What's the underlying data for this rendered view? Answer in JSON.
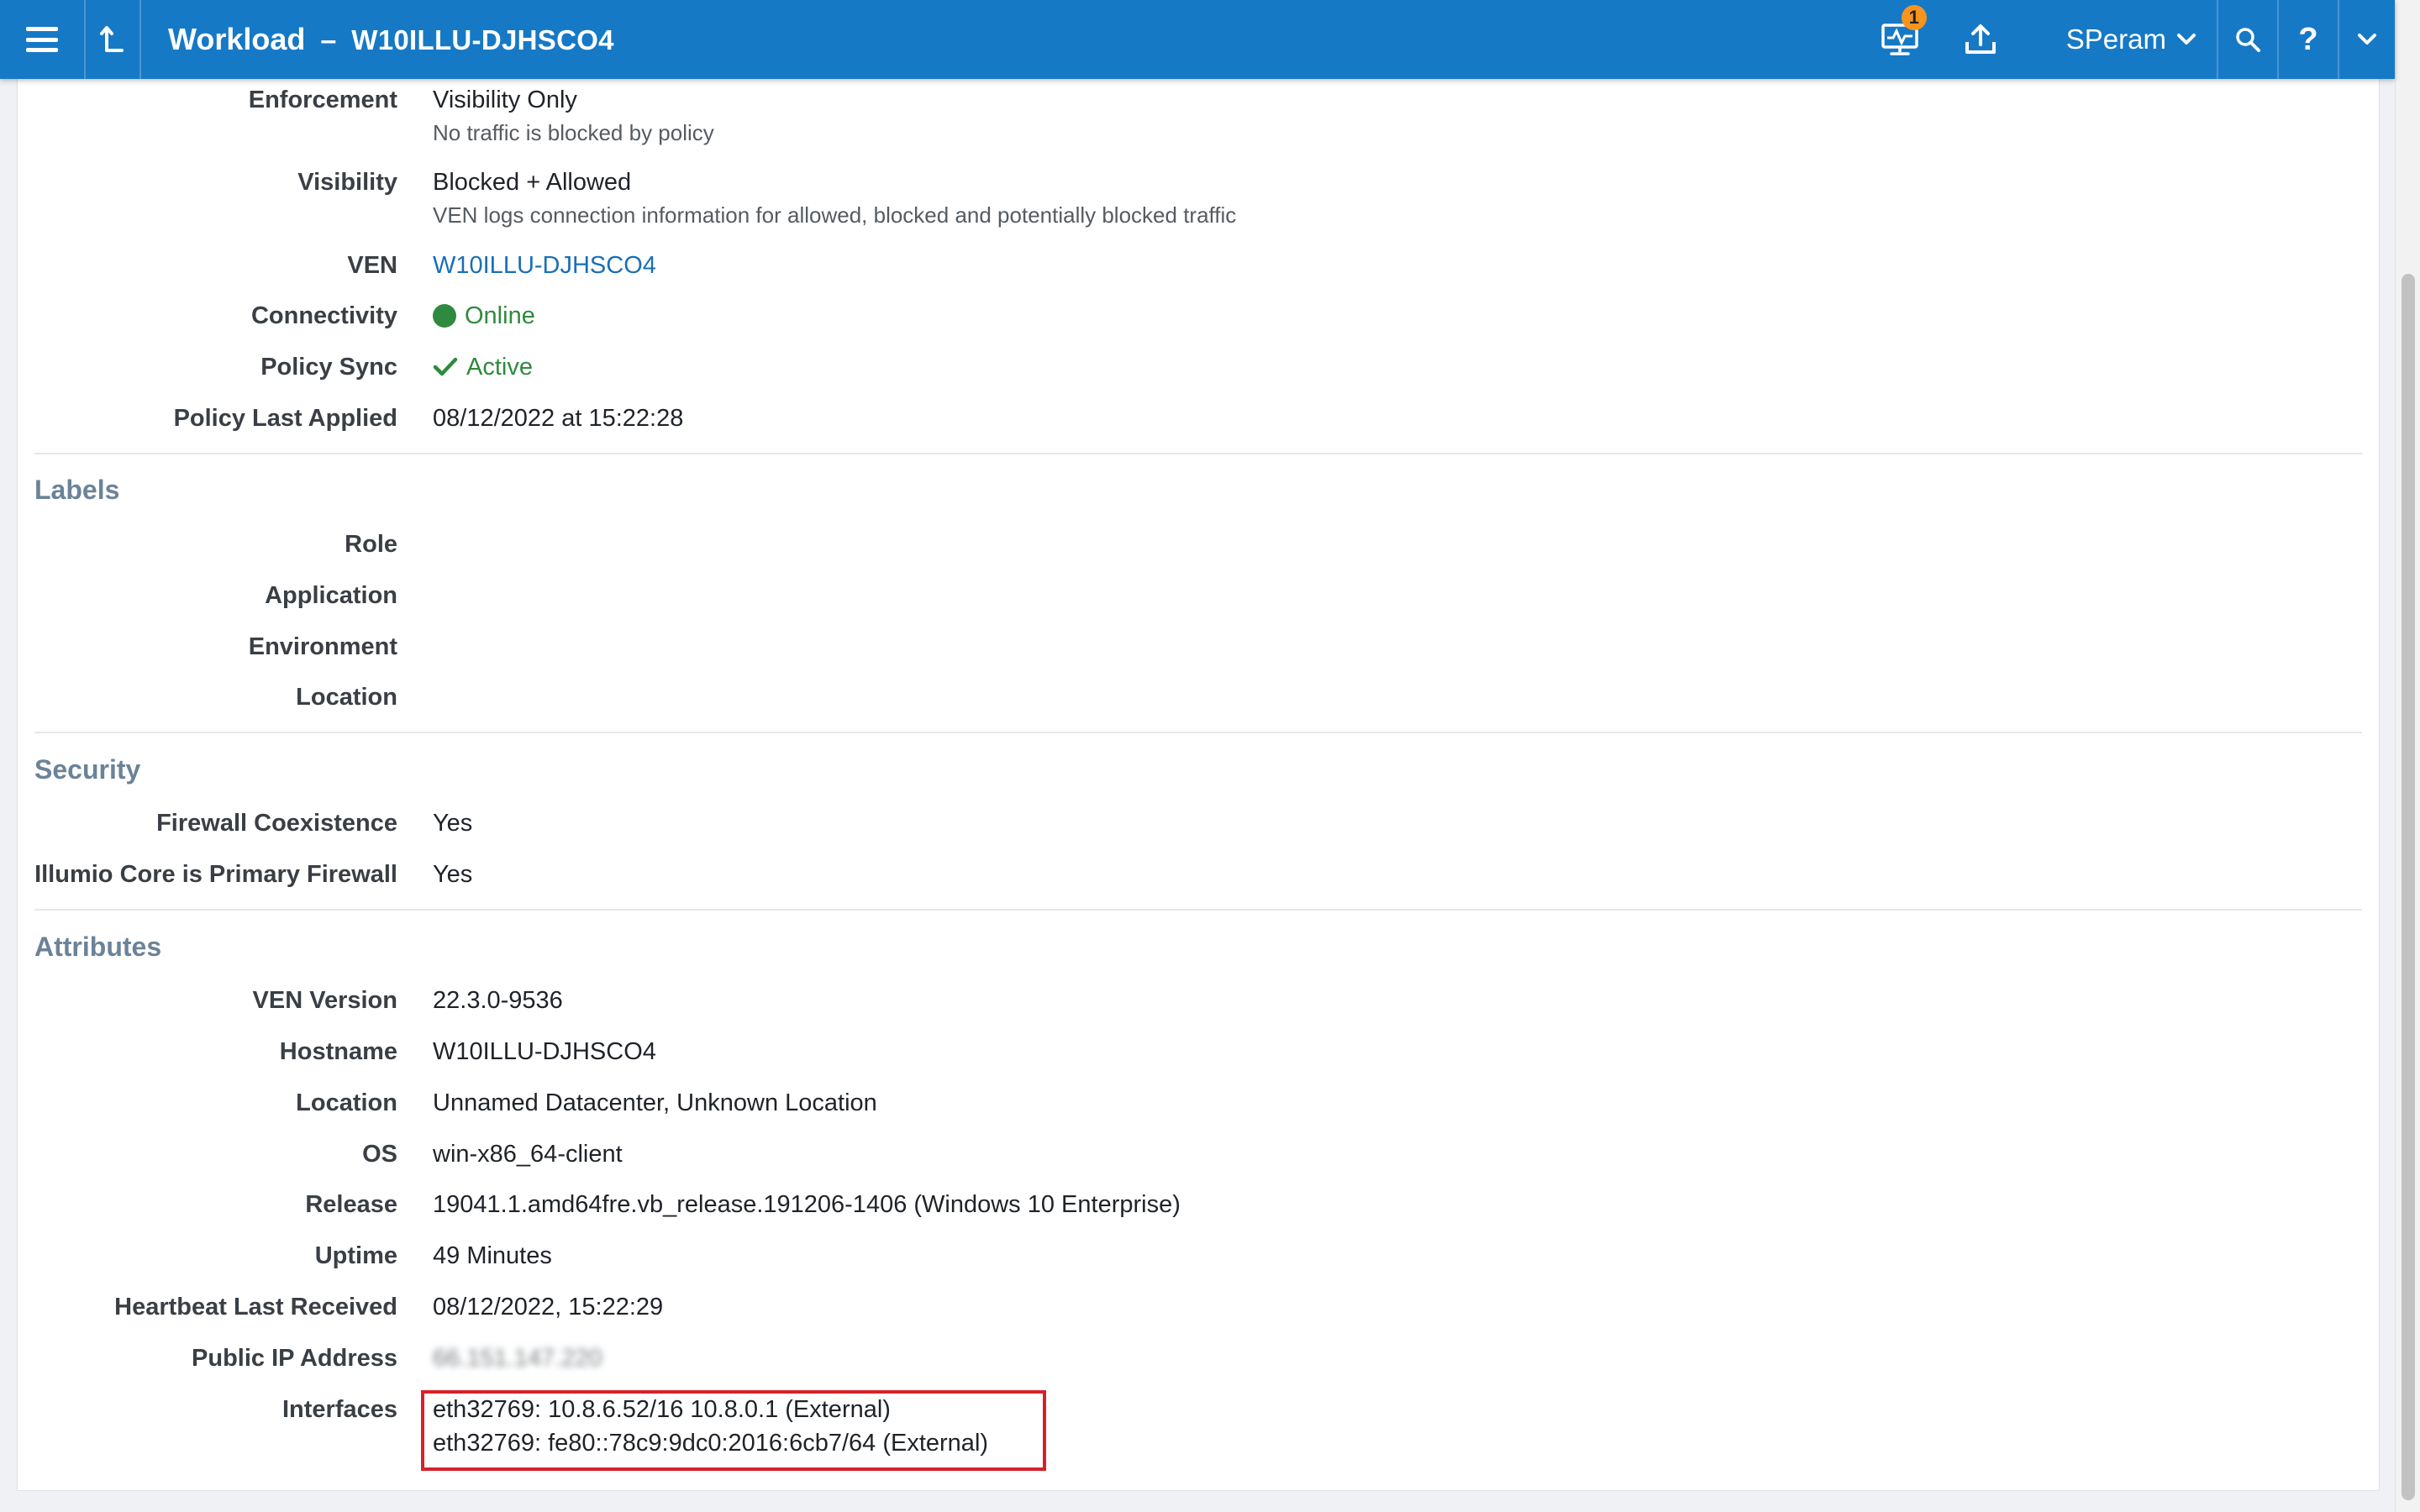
{
  "header": {
    "title": "Workload",
    "separator": "–",
    "subtitle": "W10ILLU-DJHSCO4",
    "notification_count": "1",
    "user": "SPeram",
    "help": "?",
    "brand_color": "#1679c6",
    "icons": [
      "menu-icon",
      "back-icon",
      "monitor-icon",
      "upload-icon",
      "chevron-down-icon",
      "search-icon",
      "help-icon"
    ]
  },
  "policy": {
    "enforcement_label": "Enforcement",
    "enforcement_value": "Visibility Only",
    "enforcement_desc": "No traffic is blocked by policy",
    "visibility_label": "Visibility",
    "visibility_value": "Blocked + Allowed",
    "visibility_desc": "VEN logs connection information for allowed, blocked and potentially blocked traffic",
    "ven_label": "VEN",
    "ven_value": "W10ILLU-DJHSCO4",
    "connectivity_label": "Connectivity",
    "connectivity_value": "Online",
    "policy_sync_label": "Policy Sync",
    "policy_sync_value": "Active",
    "last_applied_label": "Policy Last Applied",
    "last_applied_value": "08/12/2022 at 15:22:28"
  },
  "labels": {
    "heading": "Labels",
    "role_label": "Role",
    "application_label": "Application",
    "environment_label": "Environment",
    "location_label": "Location"
  },
  "security": {
    "heading": "Security",
    "firewall_label": "Firewall Coexistence",
    "firewall_value": "Yes",
    "primary_label": "Illumio Core is Primary Firewall",
    "primary_value": "Yes"
  },
  "attributes": {
    "heading": "Attributes",
    "ven_version_label": "VEN Version",
    "ven_version_value": "22.3.0-9536",
    "hostname_label": "Hostname",
    "hostname_value": "W10ILLU-DJHSCO4",
    "location_label": "Location",
    "location_value": "Unnamed Datacenter, Unknown Location",
    "os_label": "OS",
    "os_value": "win-x86_64-client",
    "release_label": "Release",
    "release_value": "19041.1.amd64fre.vb_release.191206-1406 (Windows 10 Enterprise)",
    "uptime_label": "Uptime",
    "uptime_value": "49 Minutes",
    "heartbeat_label": "Heartbeat Last Received",
    "heartbeat_value": "08/12/2022, 15:22:29",
    "public_ip_label": "Public IP Address",
    "public_ip_value": "66.151.147.220",
    "interfaces_label": "Interfaces",
    "interfaces": [
      "eth32769: 10.8.6.52/16 10.8.0.1 (External)",
      "eth32769: fe80::78c9:9dc0:2016:6cb7/64 (External)"
    ]
  }
}
